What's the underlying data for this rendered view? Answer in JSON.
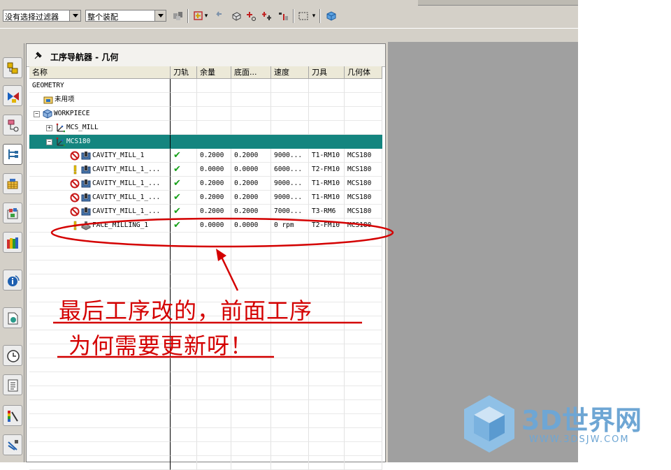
{
  "toolbar": {
    "filter_value": "没有选择过滤器",
    "assembly_value": "整个装配"
  },
  "panel": {
    "title": "工序导航器 - 几何"
  },
  "columns": [
    "名称",
    "刀轨",
    "余量",
    "底面...",
    "速度",
    "刀具",
    "几何体"
  ],
  "tree": {
    "geometry": "GEOMETRY",
    "unused": "未用项",
    "workpiece": "WORKPIECE",
    "mcs_mill": "MCS_MILL",
    "mcs180": "MCS180"
  },
  "operations": [
    {
      "name": "CAVITY_MILL_1",
      "status": "prohibited",
      "path": "✔",
      "stock": "0.2000",
      "floor": "0.2000",
      "speed": "9000...",
      "tool": "T1-RM10",
      "geometry": "MCS180"
    },
    {
      "name": "CAVITY_MILL_1_...",
      "status": "warning",
      "path": "✔",
      "stock": "0.0000",
      "floor": "0.0000",
      "speed": "6000...",
      "tool": "T2-FM10",
      "geometry": "MCS180"
    },
    {
      "name": "CAVITY_MILL_1_...",
      "status": "prohibited",
      "path": "✔",
      "stock": "0.2000",
      "floor": "0.2000",
      "speed": "9000...",
      "tool": "T1-RM10",
      "geometry": "MCS180"
    },
    {
      "name": "CAVITY_MILL_1_...",
      "status": "prohibited",
      "path": "✔",
      "stock": "0.2000",
      "floor": "0.2000",
      "speed": "9000...",
      "tool": "T1-RM10",
      "geometry": "MCS180"
    },
    {
      "name": "CAVITY_MILL_1_...",
      "status": "prohibited",
      "path": "✔",
      "stock": "0.2000",
      "floor": "0.2000",
      "speed": "7000...",
      "tool": "T3-RM6",
      "geometry": "MCS180"
    },
    {
      "name": "FACE_MILLING_1",
      "status": "warning",
      "path": "✔",
      "stock": "0.0000",
      "floor": "0.0000",
      "speed": "0 rpm",
      "tool": "T2-FM10",
      "geometry": "MCS180"
    }
  ],
  "annotation": {
    "line1": "最后工序改的，前面工序",
    "line2": "为何需要更新呀！",
    "color": "#d40000"
  },
  "watermark": {
    "text": "3D世界网",
    "url": "WWW.3DSJW.COM",
    "color": "#6ea6d4"
  },
  "colors": {
    "selected_row": "#14857f",
    "check": "#17a11a"
  }
}
